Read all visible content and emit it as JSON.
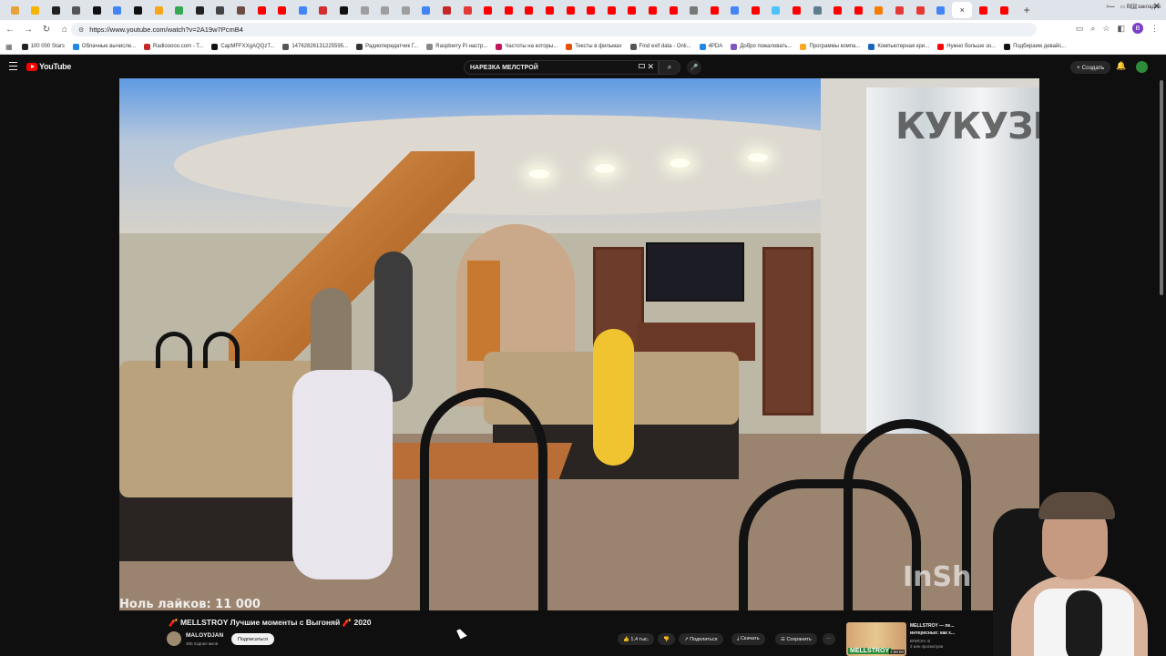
{
  "browser": {
    "tabs": [
      {
        "color": "#e8a23a"
      },
      {
        "color": "#f4b400"
      },
      {
        "color": "#222222"
      },
      {
        "color": "#555555"
      },
      {
        "color": "#111111"
      },
      {
        "color": "#4285f4"
      },
      {
        "color": "#111111"
      },
      {
        "color": "#f7a51c"
      },
      {
        "color": "#34a853"
      },
      {
        "color": "#222222"
      },
      {
        "color": "#444444"
      },
      {
        "color": "#6d4c41"
      },
      {
        "color": "#ff0000"
      },
      {
        "color": "#ff0000"
      },
      {
        "color": "#4285f4"
      },
      {
        "color": "#d32f2f"
      },
      {
        "color": "#111111"
      },
      {
        "color": "#9e9e9e"
      },
      {
        "color": "#9e9e9e"
      },
      {
        "color": "#9e9e9e"
      },
      {
        "color": "#4285f4"
      },
      {
        "color": "#c62828"
      },
      {
        "color": "#e53935"
      },
      {
        "color": "#ff0000"
      },
      {
        "color": "#ff0000"
      },
      {
        "color": "#ff0000"
      },
      {
        "color": "#ff0000"
      },
      {
        "color": "#ff0000"
      },
      {
        "color": "#ff0000"
      },
      {
        "color": "#ff0000"
      },
      {
        "color": "#ff0000"
      },
      {
        "color": "#ff0000"
      },
      {
        "color": "#ff0000"
      },
      {
        "color": "#777777"
      },
      {
        "color": "#ff0000"
      },
      {
        "color": "#4285f4"
      },
      {
        "color": "#ff0000"
      },
      {
        "color": "#4fc3f7"
      },
      {
        "color": "#ff0000"
      },
      {
        "color": "#607d8b"
      },
      {
        "color": "#ff0000"
      },
      {
        "color": "#ff0000"
      },
      {
        "color": "#f57c00"
      },
      {
        "color": "#e53935"
      },
      {
        "color": "#e53935"
      },
      {
        "color": "#4285f4"
      },
      {
        "color": "#ff0000"
      },
      {
        "color": "#ff0000"
      }
    ],
    "active_tab_close": "×",
    "new_tab": "+",
    "window_controls": [
      "–",
      "□",
      "✕"
    ],
    "nav": {
      "back": "←",
      "forward": "→",
      "reload": "↻",
      "home": "⌂"
    },
    "url": "https://www.youtube.com/watch?v=2A19w7PcmB4",
    "profile_initial": "B",
    "bookmarks": [
      {
        "label": "100 000 Stars",
        "color": "#222222"
      },
      {
        "label": "Облачные вычисле...",
        "color": "#1e88e5"
      },
      {
        "label": "Radiooooo.com - T...",
        "color": "#c62828"
      },
      {
        "label": "CapMFFXXgAQQzT...",
        "color": "#111111"
      },
      {
        "label": "14762826131225595...",
        "color": "#555555"
      },
      {
        "label": "Радиопередатчик Г...",
        "color": "#333333"
      },
      {
        "label": "Raspberry Pi настр...",
        "color": "#888888"
      },
      {
        "label": "Частоты на которы...",
        "color": "#c2185b"
      },
      {
        "label": "Тексты в фильмах",
        "color": "#e65100"
      },
      {
        "label": "Find exif data - Onli...",
        "color": "#555555"
      },
      {
        "label": "4PDA",
        "color": "#1e88e5"
      },
      {
        "label": "Добро пожаловать...",
        "color": "#7e57c2"
      },
      {
        "label": "Программы компа...",
        "color": "#f9a825"
      },
      {
        "label": "Компьютерная кри...",
        "color": "#1565c0"
      },
      {
        "label": "Нужно больше зо...",
        "color": "#ff0000"
      },
      {
        "label": "Подбираем девайс...",
        "color": "#111111"
      }
    ],
    "bookmarks_more": "»",
    "all_bookmarks": "Все закладки"
  },
  "youtube": {
    "logo_text": "YouTube",
    "search_query": "НАРЕЗКА МЕЛСТРОЙ",
    "search_clear": "✕",
    "search_button": "⌕",
    "mic": "🎤",
    "create_label": "+ Создать",
    "bell": "🔔"
  },
  "video": {
    "watermark": "КУКУЗНИК",
    "watermark2": "InSh",
    "caption": "Ноль лайков: 11 000",
    "title": "🧨 MELLSTROY Лучшие моменты с Выгоняй 🧨 2020",
    "channel_name": "MALOYDJAN",
    "subscribers": "390 подписчиков",
    "subscribe": "Подписаться",
    "likes": "👍 1,4 тыс.",
    "dislike": "👎",
    "share": "↗ Поделиться",
    "download": "⤓ Скачать",
    "save": "☰ Сохранить",
    "more": "⋯"
  },
  "recommendation": {
    "thumb_tag": "MELLSTROY",
    "duration": "2:08:00",
    "title": "MELLSTROY — пе... интересных: как х...",
    "channel": "ВПИСКА ⊘",
    "meta": "2 млн просмотров"
  }
}
